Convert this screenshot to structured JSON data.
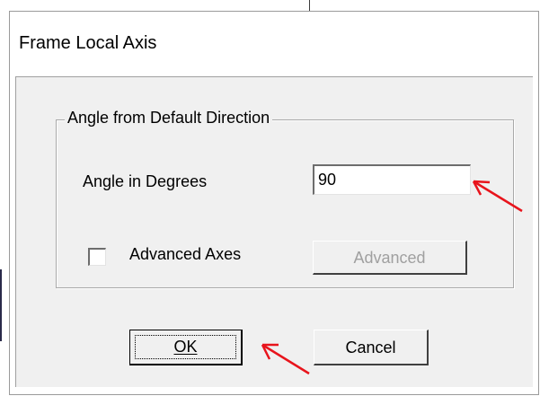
{
  "dialog": {
    "title": "Frame Local Axis"
  },
  "group": {
    "legend": "Angle from Default Direction"
  },
  "angle": {
    "label": "Angle in Degrees",
    "value": "90"
  },
  "advanced_axes": {
    "label": "Advanced Axes",
    "checked": false
  },
  "buttons": {
    "advanced_label": "Advanced",
    "ok_label": "OK",
    "cancel_label": "Cancel"
  },
  "colors": {
    "annotation_arrow": "#e8141c",
    "dialog_face": "#f0f0f0",
    "disabled_text": "#a0a0a0"
  }
}
